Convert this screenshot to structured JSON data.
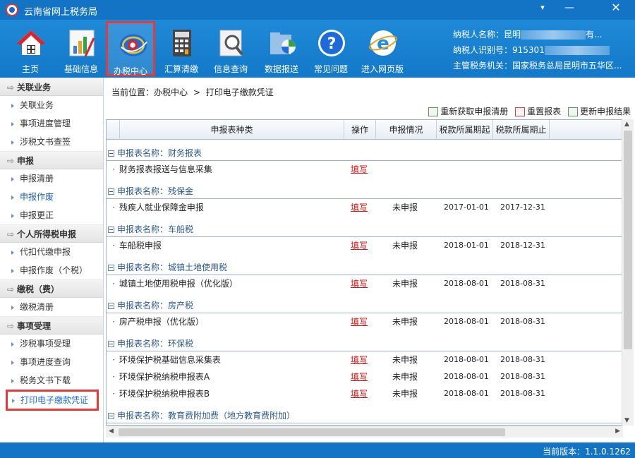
{
  "window": {
    "title": "云南省网上税务局",
    "menu_icon": "▾",
    "minimize_icon": "—",
    "close_icon": "✕"
  },
  "toolbar": [
    {
      "label": "主页",
      "icon": "home-icon"
    },
    {
      "label": "基础信息",
      "icon": "chart-icon"
    },
    {
      "label": "办税中心",
      "icon": "tax-center-icon"
    },
    {
      "label": "汇算清缴",
      "icon": "calculator-icon"
    },
    {
      "label": "信息查询",
      "icon": "magnifier-icon"
    },
    {
      "label": "数据报送",
      "icon": "folder-icon"
    },
    {
      "label": "常见问题",
      "icon": "help-icon"
    },
    {
      "label": "进入网页版",
      "icon": "ie-icon"
    }
  ],
  "taxpayer": {
    "name_label": "纳税人名称：",
    "name_value": "昆明",
    "name_suffix": "有...",
    "id_label": "纳税人识别号：",
    "id_value": "915301",
    "office_label": "主管税务机关：",
    "office_value": "国家税务总局昆明市五华区..."
  },
  "sidebar": {
    "sections": [
      {
        "title": "关联业务",
        "items": [
          "关联业务",
          "事项进度管理",
          "涉税文书查签"
        ]
      },
      {
        "title": "申报",
        "items": [
          "申报清册",
          "申报作废",
          "申报更正"
        ]
      },
      {
        "title": "个人所得税申报",
        "items": [
          "代扣代缴申报",
          "申报作废（个税）"
        ]
      },
      {
        "title": "缴税（费）",
        "items": [
          "缴税清册"
        ]
      },
      {
        "title": "事项受理",
        "items": [
          "涉税事项受理",
          "事项进度查询",
          "税务文书下载",
          "打印电子缴款凭证"
        ]
      }
    ]
  },
  "breadcrumb": {
    "label": "当前位置：",
    "path1": "办税中心",
    "sep": ">",
    "path2": "打印电子缴款凭证"
  },
  "actions": {
    "refetch": "重新获取申报清册",
    "reset": "重置报表",
    "update": "更新申报结果"
  },
  "table": {
    "headers": [
      "申报表种类",
      "操作",
      "申报情况",
      "税款所属期起",
      "税款所属期止"
    ],
    "group_prefix": "申报表名称：",
    "groups": [
      {
        "name": "财务报表",
        "rows": [
          {
            "name": "财务报表报送与信息采集",
            "op": "填写",
            "status": "",
            "start": "",
            "end": ""
          }
        ]
      },
      {
        "name": "残保金",
        "rows": [
          {
            "name": "残疾人就业保障金申报",
            "op": "填写",
            "status": "未申报",
            "start": "2017-01-01",
            "end": "2017-12-31"
          }
        ]
      },
      {
        "name": "车船税",
        "rows": [
          {
            "name": "车船税申报",
            "op": "填写",
            "status": "未申报",
            "start": "2018-01-01",
            "end": "2018-12-31"
          }
        ]
      },
      {
        "name": "城镇土地使用税",
        "rows": [
          {
            "name": "城镇土地使用税申报（优化版）",
            "op": "填写",
            "status": "未申报",
            "start": "2018-08-01",
            "end": "2018-08-31"
          }
        ]
      },
      {
        "name": "房产税",
        "rows": [
          {
            "name": "房产税申报（优化版）",
            "op": "填写",
            "status": "未申报",
            "start": "2018-08-01",
            "end": "2018-08-31"
          }
        ]
      },
      {
        "name": "环保税",
        "rows": [
          {
            "name": "环境保护税基础信息采集表",
            "op": "填写",
            "status": "未申报",
            "start": "2018-08-01",
            "end": "2018-08-31"
          },
          {
            "name": "环境保护税纳税申报表A",
            "op": "填写",
            "status": "未申报",
            "start": "2018-08-01",
            "end": "2018-08-31"
          },
          {
            "name": "环境保护税纳税申报表B",
            "op": "填写",
            "status": "未申报",
            "start": "2018-08-01",
            "end": "2018-08-31"
          }
        ]
      },
      {
        "name": "教育费附加费（地方教育费附加）",
        "rows": []
      }
    ]
  },
  "status": {
    "version": "当前版本：1.1.0.1262"
  }
}
